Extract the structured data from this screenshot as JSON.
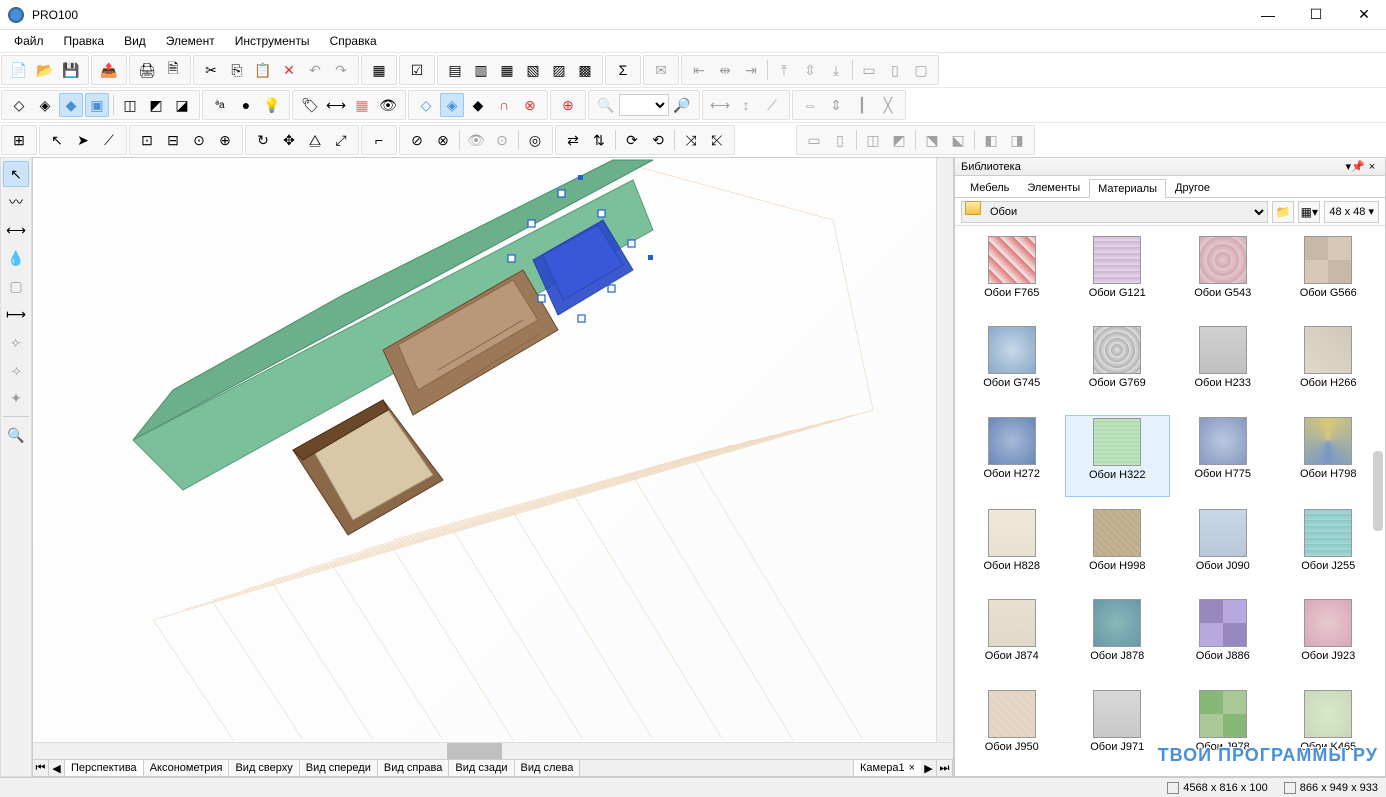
{
  "app": {
    "title": "PRO100"
  },
  "menu": [
    "Файл",
    "Правка",
    "Вид",
    "Элемент",
    "Инструменты",
    "Справка"
  ],
  "library": {
    "panel_title": "Библиотека",
    "tabs": [
      "Мебель",
      "Элементы",
      "Материалы",
      "Другое"
    ],
    "active_tab": 2,
    "folder": "Обои",
    "thumb_size": "48 x  48",
    "materials": [
      {
        "name": "Обои F765",
        "bg": "repeating-linear-gradient(45deg,#f7e9e9,#d77 10px)"
      },
      {
        "name": "Обои G121",
        "bg": "repeating-linear-gradient(0deg,#e8d5f0,#c8b5d0 6px)"
      },
      {
        "name": "Обои G543",
        "bg": "repeating-radial-gradient(circle,#e8c8d0,#d0a8b0 8px)"
      },
      {
        "name": "Обои G566",
        "bg": "repeating-conic-gradient(#d8c8b8 0 25%,#c8b8a8 0 50%)"
      },
      {
        "name": "Обои G745",
        "bg": "radial-gradient(circle,#c8d8e8,#88a8c8)"
      },
      {
        "name": "Обои G769",
        "bg": "repeating-radial-gradient(circle,#e0e0e0,#b0b0b0 6px)"
      },
      {
        "name": "Обои H233",
        "bg": "linear-gradient(#d0d0d0,#c0c0c0)"
      },
      {
        "name": "Обои H266",
        "bg": "linear-gradient(45deg,#e0d8c8,#d0c8b8)"
      },
      {
        "name": "Обои H272",
        "bg": "radial-gradient(circle,#a8b8d8,#6888b8)"
      },
      {
        "name": "Обои H322",
        "bg": "repeating-linear-gradient(0deg,#c8e8c8,#a8d8a8 4px),repeating-linear-gradient(90deg,#c8e8c8,#a8d8a8 4px)",
        "selected": true
      },
      {
        "name": "Обои H775",
        "bg": "radial-gradient(circle,#b8c8e0,#8898c0)"
      },
      {
        "name": "Обои H798",
        "bg": "conic-gradient(#d8c878,#7898c8,#d8c878)"
      },
      {
        "name": "Обои H828",
        "bg": "linear-gradient(#f0e8d8,#e8e0d0)"
      },
      {
        "name": "Обои H998",
        "bg": "repeating-linear-gradient(45deg,#c8b898,#b8a888 5px)"
      },
      {
        "name": "Обои J090",
        "bg": "linear-gradient(#c8d8e8,#b8c8d8)"
      },
      {
        "name": "Обои J255",
        "bg": "repeating-linear-gradient(0deg,#a8d8d8,#88c8c8 6px)"
      },
      {
        "name": "Обои J874",
        "bg": "linear-gradient(#e8e0d0,#e0d8c8)"
      },
      {
        "name": "Обои J878",
        "bg": "radial-gradient(circle,#88b8b8,#6898a8)"
      },
      {
        "name": "Обои J886",
        "bg": "repeating-conic-gradient(#b8a8e0 0 25%,#9888c0 0 50%)"
      },
      {
        "name": "Обои J923",
        "bg": "radial-gradient(circle,#e8c8d0,#d8a8b8)"
      },
      {
        "name": "Обои J950",
        "bg": "repeating-linear-gradient(45deg,#e8d8c8,#e0d0c0 6px)"
      },
      {
        "name": "Обои J971",
        "bg": "linear-gradient(#d8d8d8,#c8c8c8)"
      },
      {
        "name": "Обои J978",
        "bg": "repeating-conic-gradient(#a8c898 0 25%,#88b878 0 50%)"
      },
      {
        "name": "Обои K465",
        "bg": "radial-gradient(circle,#d8e8c8,#c8d8b8)"
      }
    ]
  },
  "view_tabs": [
    "Перспектива",
    "Аксонометрия",
    "Вид сверху",
    "Вид спереди",
    "Вид справа",
    "Вид сзади",
    "Вид слева"
  ],
  "camera_tab": "Камера1",
  "status": {
    "dim1": "4568 x 816 x 100",
    "dim2": "866 x 949 x 933"
  },
  "watermark": "ТВОИ ПРОГРАММЫ РУ"
}
